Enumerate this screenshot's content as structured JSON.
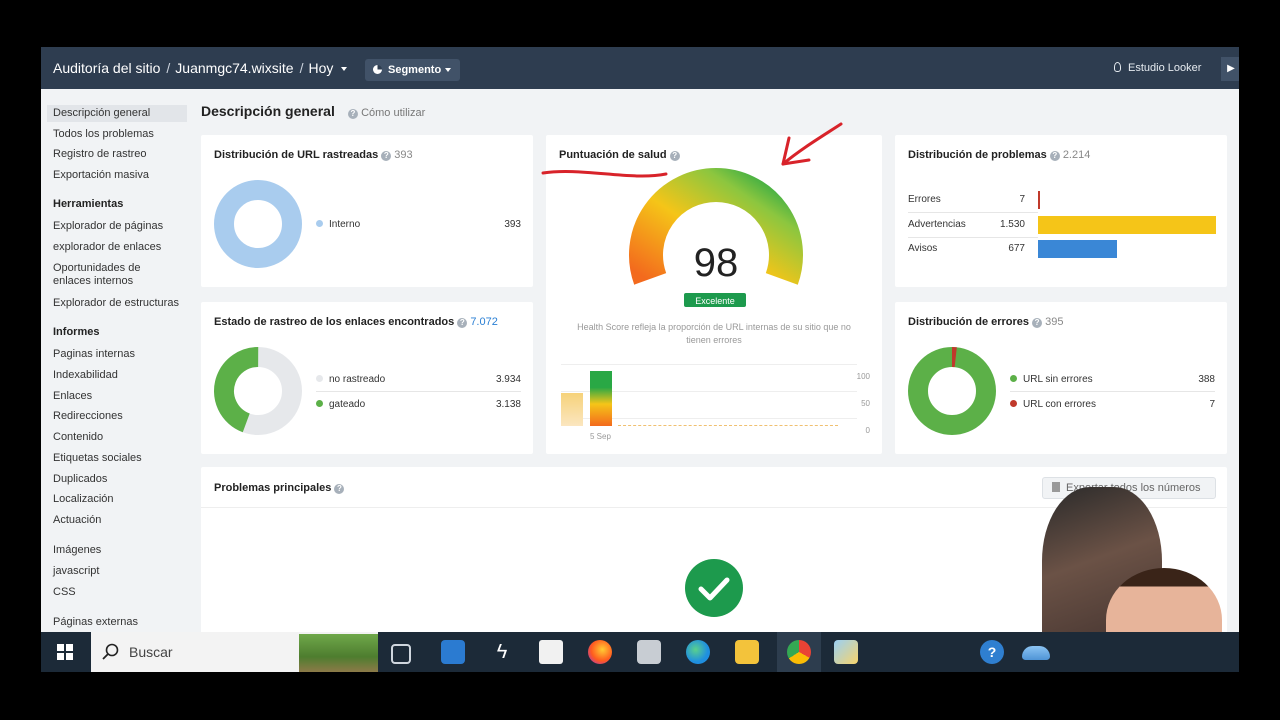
{
  "topbar": {
    "breadcrumb": [
      "Auditoría del sitio",
      "Juanmgc74.wixsite",
      "Hoy"
    ],
    "segment_label": "Segmento",
    "looker_label": "Estudio Looker"
  },
  "sidebar": {
    "items_top": [
      "Descripción general",
      "Todos los problemas",
      "Registro de rastreo",
      "Exportación masiva"
    ],
    "tools_heading": "Herramientas",
    "tools": [
      "Explorador de páginas",
      "explorador de enlaces",
      "Oportunidades de enlaces internos",
      "Explorador de estructuras"
    ],
    "reports_heading": "Informes",
    "reports": [
      "Paginas internas",
      "Indexabilidad",
      "Enlaces",
      "Redirecciones",
      "Contenido",
      "Etiquetas sociales",
      "Duplicados",
      "Localización",
      "Actuación"
    ],
    "assets": [
      "Imágenes",
      "javascript",
      "CSS"
    ],
    "external": [
      "Páginas externas"
    ]
  },
  "main": {
    "title": "Descripción general",
    "how_to": "Cómo utilizar"
  },
  "url_distribution": {
    "title": "Distribución de URL rastreadas",
    "count": "393",
    "legend": [
      {
        "label": "Interno",
        "value": "393",
        "color": "#a9ccee"
      }
    ]
  },
  "crawl_status": {
    "title": "Estado de rastreo de los enlaces encontrados",
    "count": "7.072",
    "rows": [
      {
        "label": "no rastreado",
        "value": "3.934",
        "color": "#e6e8eb"
      },
      {
        "label": "gateado",
        "value": "3.138",
        "color": "#5cb048"
      }
    ]
  },
  "health": {
    "title": "Puntuación de salud",
    "score": "98",
    "score_value": 98,
    "badge": "Excelente",
    "description": "Health Score refleja la proporción de URL internas de su sitio que no tienen errores",
    "axis": [
      "100",
      "50",
      "0"
    ],
    "date_label": "5 Sep"
  },
  "issues_distribution": {
    "title": "Distribución de problemas",
    "count": "2.214",
    "rows": [
      {
        "label": "Errores",
        "value": "7",
        "color": "#c0392b",
        "amount": 7
      },
      {
        "label": "Advertencias",
        "value": "1.530",
        "color": "#f5c518",
        "amount": 1530
      },
      {
        "label": "Avisos",
        "value": "677",
        "color": "#3a87d6",
        "amount": 677
      }
    ]
  },
  "errors_distribution": {
    "title": "Distribución de errores",
    "count": "395",
    "rows": [
      {
        "label": "URL sin errores",
        "value": "388",
        "color": "#5cb048"
      },
      {
        "label": "URL con errores",
        "value": "7",
        "color": "#c0392b"
      }
    ]
  },
  "top_issues": {
    "title": "Problemas principales",
    "button_label": "Exportar todos los números"
  },
  "taskbar": {
    "search_placeholder": "Buscar"
  },
  "colors": {
    "topbar": "#2e3d50",
    "accent_green": "#5cb048",
    "accent_red": "#c0392b"
  }
}
